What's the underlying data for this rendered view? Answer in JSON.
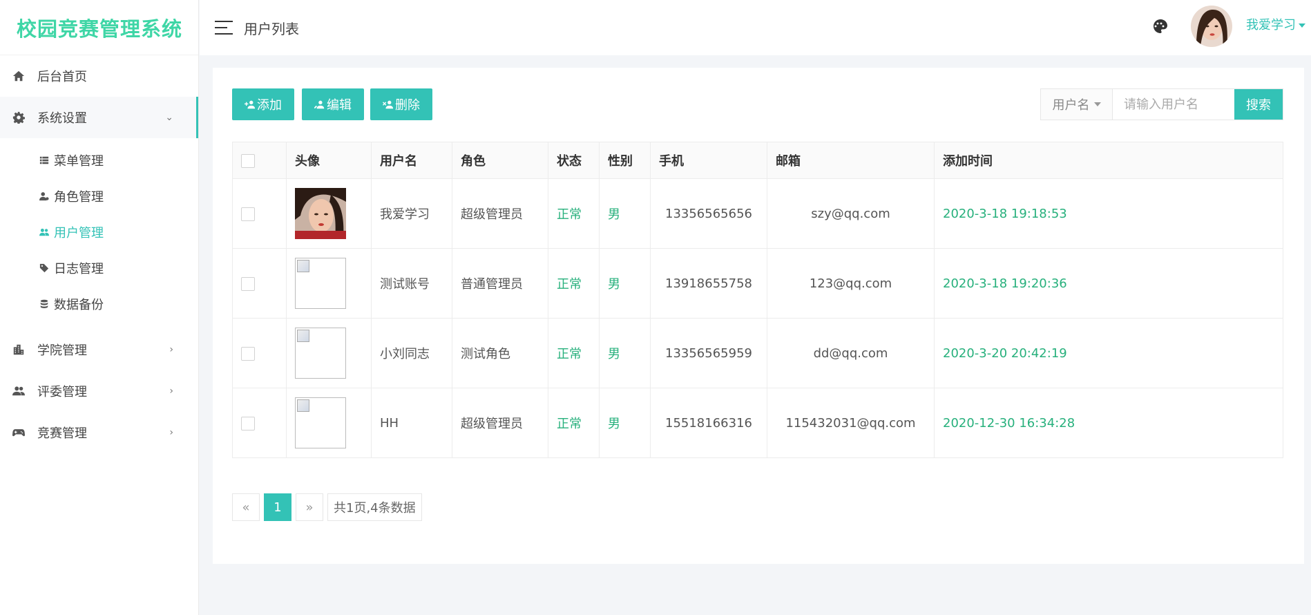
{
  "app": {
    "brand": "校园竞赛管理系统"
  },
  "header": {
    "menu_icon": "hamburger-icon",
    "title": "用户列表",
    "theme_icon": "palette-icon",
    "user_name": "我爱学习"
  },
  "sidebar": {
    "items": [
      {
        "label": "后台首页",
        "icon": "home-icon"
      },
      {
        "label": "系统设置",
        "icon": "gear-icon",
        "expanded": true,
        "children": [
          {
            "label": "菜单管理",
            "icon": "list-icon"
          },
          {
            "label": "角色管理",
            "icon": "user-role-icon"
          },
          {
            "label": "用户管理",
            "icon": "users-icon",
            "active": true
          },
          {
            "label": "日志管理",
            "icon": "tag-icon"
          },
          {
            "label": "数据备份",
            "icon": "database-icon"
          }
        ]
      },
      {
        "label": "学院管理",
        "icon": "building-icon"
      },
      {
        "label": "评委管理",
        "icon": "people-icon"
      },
      {
        "label": "竞赛管理",
        "icon": "gamepad-icon"
      }
    ]
  },
  "toolbar": {
    "add_label": "添加",
    "edit_label": "编辑",
    "delete_label": "删除"
  },
  "search": {
    "field_label": "用户名",
    "placeholder": "请输入用户名",
    "button_label": "搜索"
  },
  "table": {
    "headers": [
      "",
      "头像",
      "用户名",
      "角色",
      "状态",
      "性别",
      "手机",
      "邮箱",
      "添加时间"
    ],
    "rows": [
      {
        "avatar": "photo",
        "username": "我爱学习",
        "role": "超级管理员",
        "status": "正常",
        "gender": "男",
        "phone": "13356565656",
        "email": "szy@qq.com",
        "added": "2020-3-18 19:18:53"
      },
      {
        "avatar": "broken",
        "username": "测试账号",
        "role": "普通管理员",
        "status": "正常",
        "gender": "男",
        "phone": "13918655758",
        "email": "123@qq.com",
        "added": "2020-3-18 19:20:36"
      },
      {
        "avatar": "broken",
        "username": "小刘同志",
        "role": "测试角色",
        "status": "正常",
        "gender": "男",
        "phone": "13356565959",
        "email": "dd@qq.com",
        "added": "2020-3-20 20:42:19"
      },
      {
        "avatar": "broken",
        "username": "HH",
        "role": "超级管理员",
        "status": "正常",
        "gender": "男",
        "phone": "15518166316",
        "email": "115432031@qq.com",
        "added": "2020-12-30 16:34:28"
      }
    ]
  },
  "pagination": {
    "prev": "«",
    "current": "1",
    "next": "»",
    "info": "共1页,4条数据"
  },
  "colors": {
    "brand": "#3fd6a6",
    "accent": "#33c2b6",
    "status_green": "#27b07c"
  }
}
